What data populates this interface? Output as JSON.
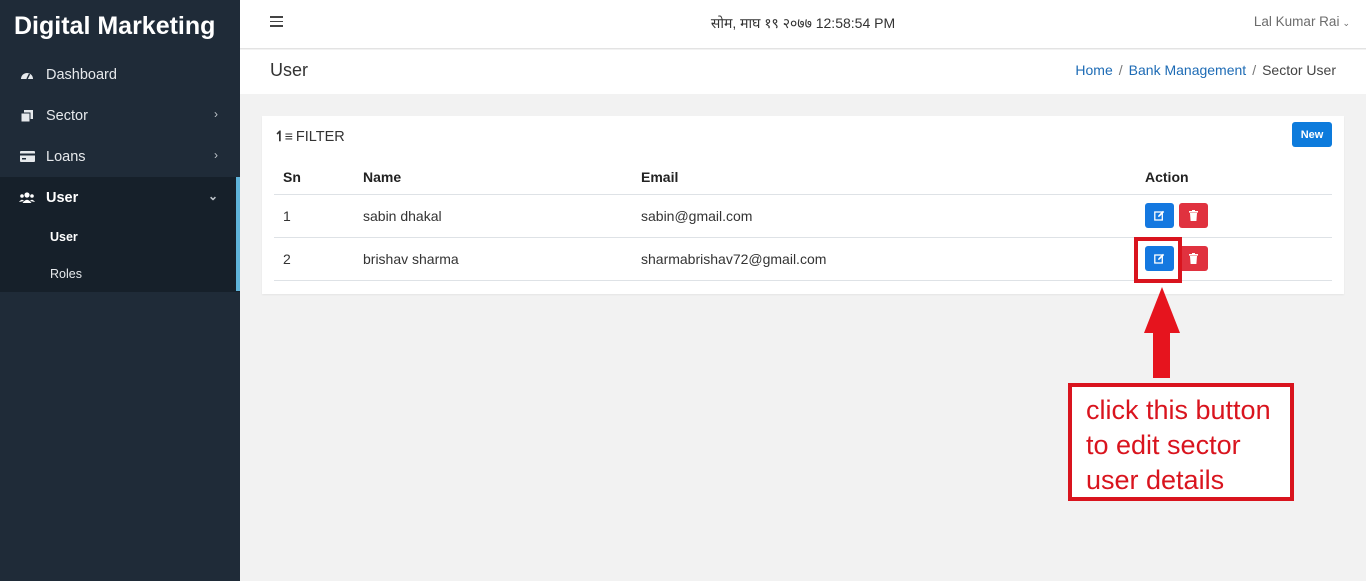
{
  "app": {
    "brand": "Digital Marketing"
  },
  "sidebar": {
    "items": [
      {
        "label": "Dashboard",
        "icon": "dashboard-icon"
      },
      {
        "label": "Sector",
        "icon": "sector-icon"
      },
      {
        "label": "Loans",
        "icon": "loans-icon"
      },
      {
        "label": "User",
        "icon": "users-icon"
      }
    ],
    "submenu": [
      {
        "label": "User"
      },
      {
        "label": "Roles"
      }
    ]
  },
  "topbar": {
    "datetime": "सोम, माघ १९ २०७७ 12:58:54 PM",
    "username": "Lal Kumar Rai"
  },
  "page": {
    "title": "User",
    "breadcrumb": [
      "Home",
      "Bank Management",
      "Sector User"
    ]
  },
  "card": {
    "filter_label": "FILTER",
    "new_label": "New"
  },
  "table": {
    "headers": [
      "Sn",
      "Name",
      "Email",
      "Action"
    ],
    "rows": [
      {
        "sn": "1",
        "name": "sabin dhakal",
        "email": "sabin@gmail.com"
      },
      {
        "sn": "2",
        "name": "brishav sharma",
        "email": "sharmabrishav72@gmail.com"
      }
    ]
  },
  "annotation": {
    "lines": [
      "click this button",
      "to edit sector",
      "user details"
    ]
  },
  "colors": {
    "sidebar_bg": "#1f2b38",
    "primary": "#1478e0",
    "danger": "#e0323f",
    "annotation": "#d9141e"
  }
}
